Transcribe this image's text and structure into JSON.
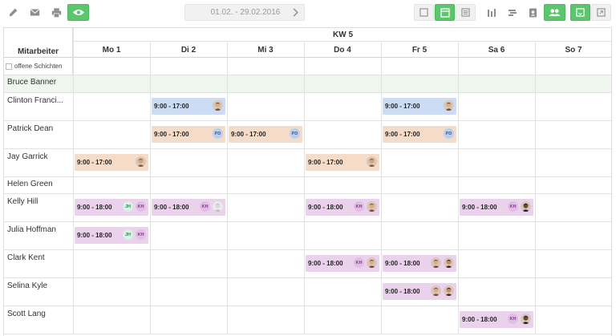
{
  "toolbar": {
    "left_icons": [
      "pencil-icon",
      "mail-icon",
      "print-icon",
      "eye-icon"
    ],
    "date_range": "01.02. - 29.02.2016",
    "right_icons": [
      "view-single-icon",
      "view-week-icon",
      "view-list-icon",
      "chart-bars-icon",
      "align-icon",
      "person-card-icon",
      "group-icon",
      "export-icon",
      "fullscreen-icon"
    ],
    "accent_color": "#5cc66d"
  },
  "schedule": {
    "column_title": "Mitarbeiter",
    "week_label": "KW 5",
    "days": [
      "Mo 1",
      "Di 2",
      "Mi 3",
      "Do 4",
      "Fr 5",
      "Sa 6",
      "So 7"
    ],
    "open_shifts_label": "offene Schichten",
    "employees": [
      {
        "name": "Bruce Banner",
        "highlight": true,
        "shifts": []
      },
      {
        "name": "Clinton Franci...",
        "shifts": [
          {
            "day": 1,
            "time": "9:00 - 17:00",
            "color": "blue",
            "badges": [
              {
                "type": "avatar",
                "tone": "female"
              }
            ]
          },
          {
            "day": 4,
            "time": "9:00 - 17:00",
            "color": "blue",
            "badges": [
              {
                "type": "avatar",
                "tone": "female"
              }
            ]
          }
        ]
      },
      {
        "name": "Patrick Dean",
        "shifts": [
          {
            "day": 1,
            "time": "9:00 - 17:00",
            "color": "orange",
            "badges": [
              {
                "type": "initials",
                "text": "PD",
                "tone": "pd"
              }
            ]
          },
          {
            "day": 2,
            "time": "9:00 - 17:00",
            "color": "orange",
            "badges": [
              {
                "type": "initials",
                "text": "PD",
                "tone": "pd"
              }
            ]
          },
          {
            "day": 4,
            "time": "9:00 - 17:00",
            "color": "orange",
            "badges": [
              {
                "type": "initials",
                "text": "PD",
                "tone": "pd"
              }
            ]
          }
        ]
      },
      {
        "name": "Jay Garrick",
        "shifts": [
          {
            "day": 0,
            "time": "9:00 - 17:00",
            "color": "orange",
            "badges": [
              {
                "type": "avatar",
                "tone": "male"
              }
            ]
          },
          {
            "day": 3,
            "time": "9:00 - 17:00",
            "color": "orange",
            "badges": [
              {
                "type": "avatar",
                "tone": "male"
              }
            ]
          }
        ]
      },
      {
        "name": "Helen Green",
        "shifts": []
      },
      {
        "name": "Kelly Hill",
        "shifts": [
          {
            "day": 0,
            "time": "9:00 - 18:00",
            "color": "purple",
            "badges": [
              {
                "type": "initials",
                "text": "JH",
                "tone": "jh"
              },
              {
                "type": "initials",
                "text": "KH",
                "tone": "kh"
              }
            ]
          },
          {
            "day": 1,
            "time": "9:00 - 18:00",
            "color": "purple",
            "badges": [
              {
                "type": "initials",
                "text": "KH",
                "tone": "kh"
              },
              {
                "type": "avatar",
                "tone": "placeholder"
              }
            ]
          },
          {
            "day": 3,
            "time": "9:00 - 18:00",
            "color": "purple",
            "badges": [
              {
                "type": "initials",
                "text": "KH",
                "tone": "kh"
              },
              {
                "type": "avatar",
                "tone": "female"
              }
            ]
          },
          {
            "day": 5,
            "time": "9:00 - 18:00",
            "color": "purple",
            "badges": [
              {
                "type": "initials",
                "text": "KH",
                "tone": "kh"
              },
              {
                "type": "avatar",
                "tone": "dark"
              }
            ]
          }
        ]
      },
      {
        "name": "Julia Hoffman",
        "shifts": [
          {
            "day": 0,
            "time": "9:00 - 18:00",
            "color": "purple",
            "badges": [
              {
                "type": "initials",
                "text": "JH",
                "tone": "jh"
              },
              {
                "type": "initials",
                "text": "KH",
                "tone": "kh"
              }
            ]
          }
        ]
      },
      {
        "name": "Clark Kent",
        "shifts": [
          {
            "day": 3,
            "time": "9:00 - 18:00",
            "color": "purple",
            "badges": [
              {
                "type": "initials",
                "text": "KH",
                "tone": "kh"
              },
              {
                "type": "avatar",
                "tone": "female"
              }
            ]
          },
          {
            "day": 4,
            "time": "9:00 - 18:00",
            "color": "purple",
            "badges": [
              {
                "type": "avatar",
                "tone": "female"
              },
              {
                "type": "avatar",
                "tone": "female2"
              }
            ]
          }
        ]
      },
      {
        "name": "Selina Kyle",
        "shifts": [
          {
            "day": 4,
            "time": "9:00 - 18:00",
            "color": "purple",
            "badges": [
              {
                "type": "avatar",
                "tone": "female"
              },
              {
                "type": "avatar",
                "tone": "female2"
              }
            ]
          }
        ]
      },
      {
        "name": "Scott Lang",
        "shifts": [
          {
            "day": 5,
            "time": "9:00 - 18:00",
            "color": "purple",
            "badges": [
              {
                "type": "initials",
                "text": "KH",
                "tone": "kh"
              },
              {
                "type": "avatar",
                "tone": "dark"
              }
            ]
          }
        ]
      }
    ]
  }
}
